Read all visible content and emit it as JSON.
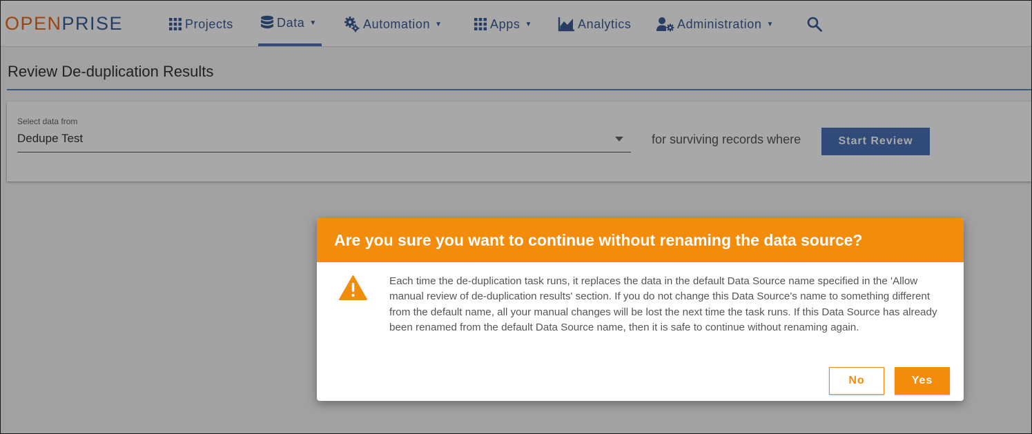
{
  "brand": {
    "part1": "OPEN",
    "part2": "PRISE"
  },
  "nav": {
    "projects": "Projects",
    "data": "Data",
    "automation": "Automation",
    "apps": "Apps",
    "analytics": "Analytics",
    "administration": "Administration",
    "active": "Data",
    "icons": [
      "grid-icon",
      "database-icon",
      "gears-icon",
      "grid-icon",
      "chart-icon",
      "user-gear-icon",
      "search-icon"
    ]
  },
  "page": {
    "title": "Review De-duplication Results"
  },
  "selector": {
    "label": "Select data from",
    "value": "Dedupe Test",
    "suffix": "for surviving records where",
    "button": "Start Review"
  },
  "dialog": {
    "title": "Are you sure you want to continue without renaming the data source?",
    "icon": "warning-icon",
    "message": "Each time the de-duplication task runs, it replaces the data in the default Data Source name specified in the 'Allow manual review of de-duplication results' section. If you do not change this Data Source's name to something different from the default name, all your manual changes will be lost the next time the task runs. If this Data Source has already been renamed from the default Data Source name, then it is safe to continue without renaming again.",
    "no_label": "No",
    "yes_label": "Yes"
  },
  "colors": {
    "accent": "#f38b0b",
    "brand_orange": "#e8681f",
    "brand_blue": "#3a5f9a",
    "nav_blue": "#3a5c95",
    "primary": "#4a72b8"
  }
}
